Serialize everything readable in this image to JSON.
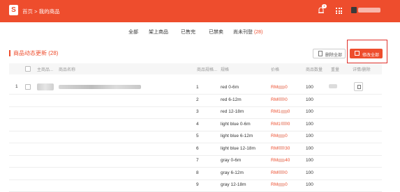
{
  "header": {
    "breadcrumb_home": "首页",
    "breadcrumb_sep": ">",
    "breadcrumb_current": "我的商品",
    "notification_count": "1",
    "accent_color": "#ee4d2d"
  },
  "tabs": [
    {
      "label": "全部"
    },
    {
      "label": "架上商品"
    },
    {
      "label": "已售完"
    },
    {
      "label": "已禁卖"
    },
    {
      "label": "尚未刊登",
      "count": "(28)"
    }
  ],
  "section": {
    "title": "商品动态更新 (28)",
    "delete_all_label": "删除全部",
    "fix_all_label": "修改全部"
  },
  "table": {
    "headers": {
      "main_product": "主商品...",
      "product_name": "商品名称",
      "spec_id": "商品规格...",
      "spec": "规格",
      "price": "价格",
      "quantity": "商品数量",
      "weight": "重量",
      "action": "详情/删除"
    },
    "row_number": "1",
    "rows": [
      {
        "index": "1",
        "spec": "red 0-6m",
        "price_prefix": "RM",
        "price_suffix": "0",
        "qty": "100"
      },
      {
        "index": "2",
        "spec": "red 6-12m",
        "price_prefix": "RM",
        "price_suffix": "0",
        "qty": "100"
      },
      {
        "index": "3",
        "spec": "red 12-18m",
        "price_prefix": "RM1",
        "price_suffix": "0",
        "qty": "100"
      },
      {
        "index": "4",
        "spec": "light blue 0-6m",
        "price_prefix": "RM1",
        "price_suffix": "0",
        "qty": "100"
      },
      {
        "index": "5",
        "spec": "light blue 6-12m",
        "price_prefix": "RM",
        "price_suffix": "0",
        "qty": "100"
      },
      {
        "index": "6",
        "spec": "light blue 12-18m",
        "price_prefix": "RM",
        "price_suffix": "30",
        "qty": "100"
      },
      {
        "index": "7",
        "spec": "gray 0-6m",
        "price_prefix": "RM",
        "price_suffix": "40",
        "qty": "100"
      },
      {
        "index": "8",
        "spec": "gray 6-12m",
        "price_prefix": "RM",
        "price_suffix": "0",
        "qty": "100"
      },
      {
        "index": "9",
        "spec": "gray 12-18m",
        "price_prefix": "RM",
        "price_suffix": "0",
        "qty": "100"
      }
    ]
  }
}
